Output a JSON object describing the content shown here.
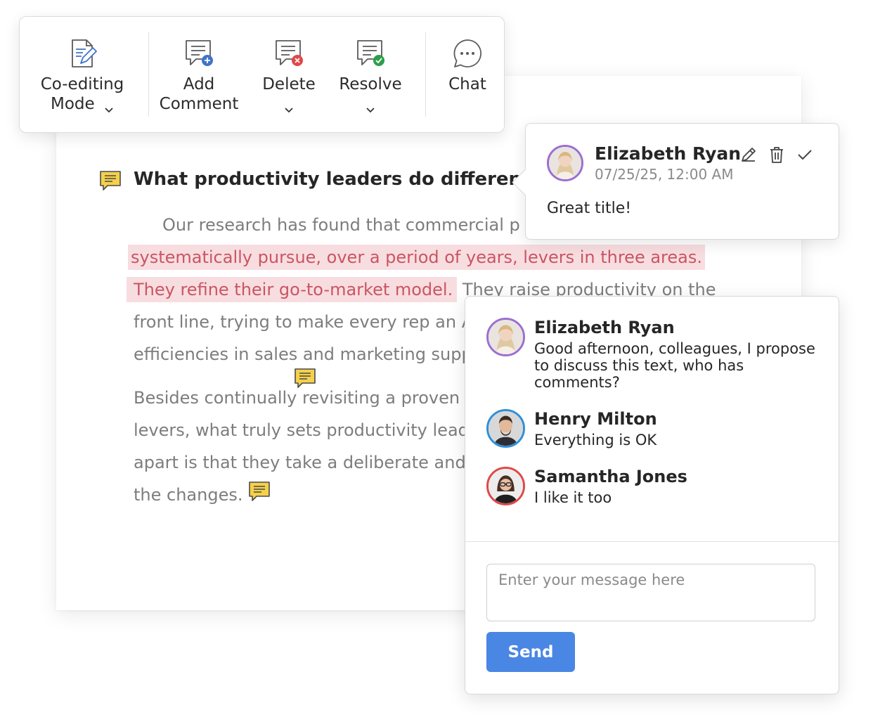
{
  "toolbar": {
    "items": [
      {
        "label_line1": "Co-editing",
        "label_line2": "Mode",
        "icon": "coediting-mode-icon",
        "has_dropdown": true
      },
      {
        "label_line1": "Add",
        "label_line2": "Comment",
        "icon": "add-comment-icon",
        "has_dropdown": false
      },
      {
        "label_line1": "Delete",
        "icon": "delete-comment-icon",
        "has_dropdown": true
      },
      {
        "label_line1": "Resolve",
        "icon": "resolve-comment-icon",
        "has_dropdown": true
      },
      {
        "label_line1": "Chat",
        "icon": "chat-icon",
        "has_dropdown": false
      }
    ]
  },
  "document": {
    "title": "What productivity leaders do differently",
    "lines": [
      "Our research has found that commercial p",
      "systematically pursue, over a period of years, levers in three areas.",
      "They refine their go-to-market model.",
      " They raise productivity on the",
      "front line, trying to make every rep an A",
      "efficiencies in sales and marketing supp",
      "Besides continually revisiting a proven",
      "levers, what truly sets productivity lead",
      "apart is that they take a deliberate and",
      "the changes."
    ]
  },
  "comment_popover": {
    "author": "Elizabeth Ryan",
    "date": "07/25/25, 12:00 AM",
    "text": "Great title!"
  },
  "chat": {
    "messages": [
      {
        "author": "Elizabeth Ryan",
        "text": "Good afternoon, colleagues, I propose to discuss this text, who has comments?",
        "ring_color": "#9b6fd1"
      },
      {
        "author": "Henry Milton",
        "text": "Everything is OK",
        "ring_color": "#2f8fd8"
      },
      {
        "author": "Samantha Jones",
        "text": "I like it too",
        "ring_color": "#e04848"
      }
    ],
    "input_placeholder": "Enter your message here",
    "send_label": "Send"
  },
  "colors": {
    "accent": "#4a86e4",
    "highlight_bg": "#f8dde0",
    "highlight_text": "#c95663",
    "comment_flag": "#f5d04a"
  }
}
